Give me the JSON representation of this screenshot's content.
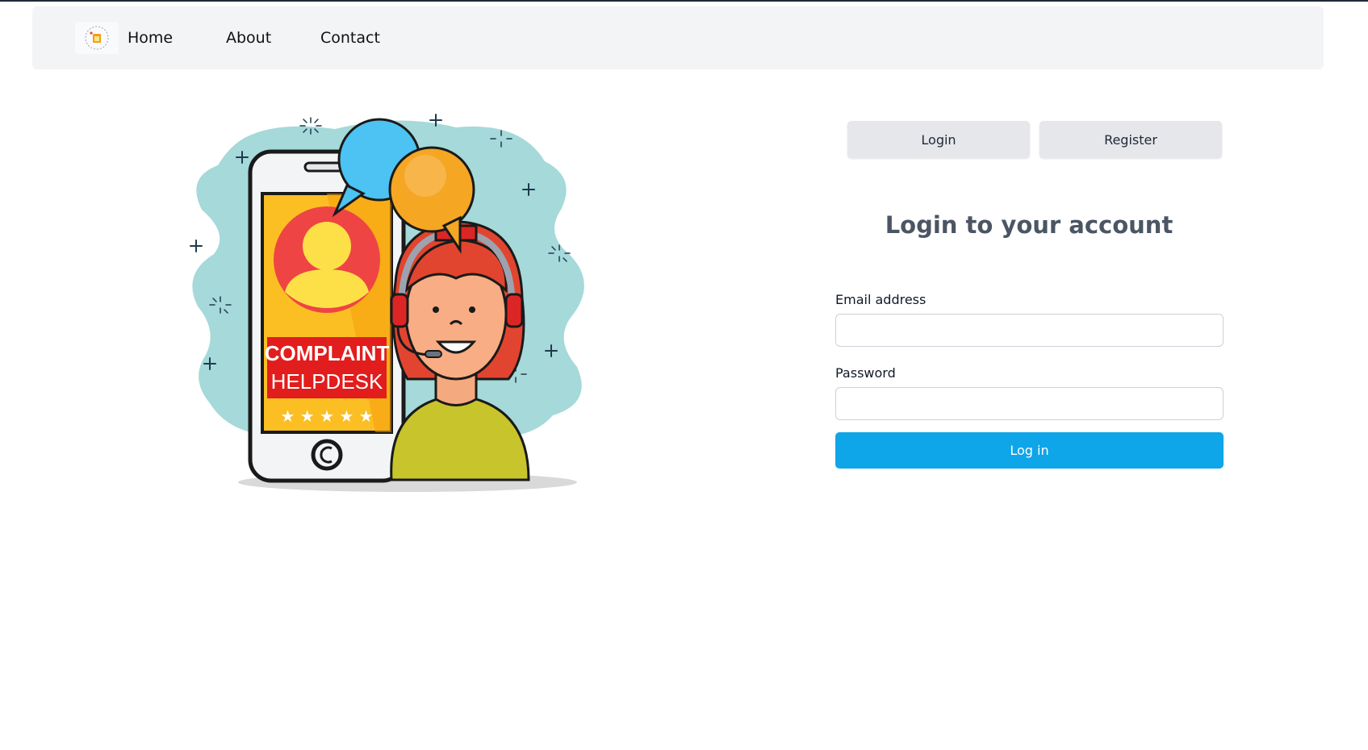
{
  "nav": {
    "logo_icon": "helpdesk-logo-icon",
    "links": [
      {
        "label": "Home"
      },
      {
        "label": "About"
      },
      {
        "label": "Contact"
      }
    ]
  },
  "illustration": {
    "line1": "COMPLAINT",
    "line2": "HELPDESK",
    "stars": "★ ★ ★ ★ ★"
  },
  "auth_tabs": {
    "login_label": "Login",
    "register_label": "Register"
  },
  "form": {
    "title": "Login to your account",
    "email_label": "Email address",
    "email_value": "",
    "password_label": "Password",
    "password_value": "",
    "submit_label": "Log in"
  },
  "colors": {
    "primary": "#0ea5e9",
    "navbar_bg": "#f3f4f6",
    "tab_bg": "#e5e7eb",
    "title_text": "#4b5563"
  }
}
